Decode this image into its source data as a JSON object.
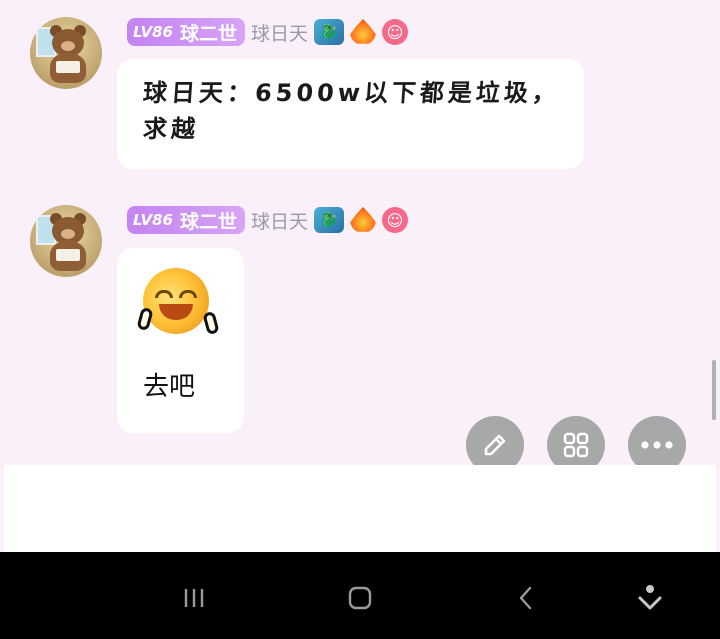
{
  "messages": [
    {
      "level": "LV86",
      "badge_name": "球二世",
      "username": "球日天",
      "badges": [
        "dragon-badge",
        "fire-badge",
        "smile-badge"
      ],
      "text_line1": "球日天：6500w以下都是垃圾，",
      "text_line2": "求越"
    },
    {
      "level": "LV86",
      "badge_name": "球二世",
      "username": "球日天",
      "badges": [
        "dragon-badge",
        "fire-badge",
        "smile-badge"
      ],
      "sticker": "smiling-face-sticker",
      "sticker_caption": "去吧"
    }
  ],
  "floating_actions": [
    {
      "icon": "pencil-icon"
    },
    {
      "icon": "grid-icon"
    },
    {
      "icon": "more-dots-icon"
    }
  ],
  "navigation_bar": {
    "buttons": [
      "recent-apps-icon",
      "home-icon",
      "back-icon",
      "assistant-icon"
    ]
  },
  "colors": {
    "background": "#faf0f9",
    "bubble": "#ffffff",
    "badge_gradient_start": "#c483f2",
    "fab": "#a8a8a8",
    "navbar": "#000000"
  }
}
